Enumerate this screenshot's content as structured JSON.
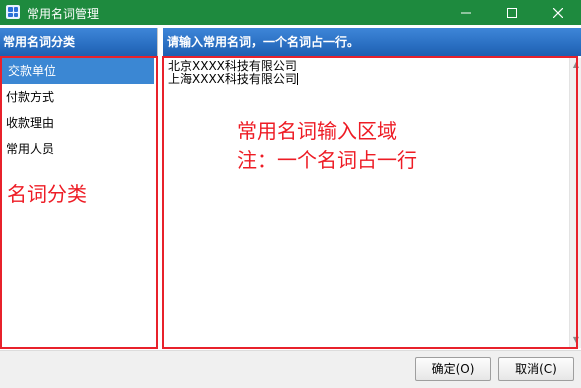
{
  "window": {
    "title": "常用名词管理",
    "controls": {
      "minimize": "—",
      "maximize": "☐",
      "close": "✕"
    },
    "title_bar_color": "#1e8a3e"
  },
  "left_panel": {
    "header": "常用名词分类",
    "items": [
      {
        "label": "交款单位",
        "selected": true
      },
      {
        "label": "付款方式",
        "selected": false
      },
      {
        "label": "收款理由",
        "selected": false
      },
      {
        "label": "常用人员",
        "selected": false
      }
    ],
    "annotation": "名词分类"
  },
  "right_panel": {
    "header": "请输入常用名词，一个名词占一行。",
    "lines": [
      "北京XXXX科技有限公司",
      "上海XXXX科技有限公司"
    ],
    "annotation_line1": "常用名词输入区域",
    "annotation_line2": "注：一个名词占一行"
  },
  "buttons": {
    "ok": "确定(O)",
    "cancel": "取消(C)"
  },
  "colors": {
    "header_blue": "#2a6fc2",
    "selection_blue": "#3b87d3",
    "annotation_red": "#ee1c25"
  }
}
